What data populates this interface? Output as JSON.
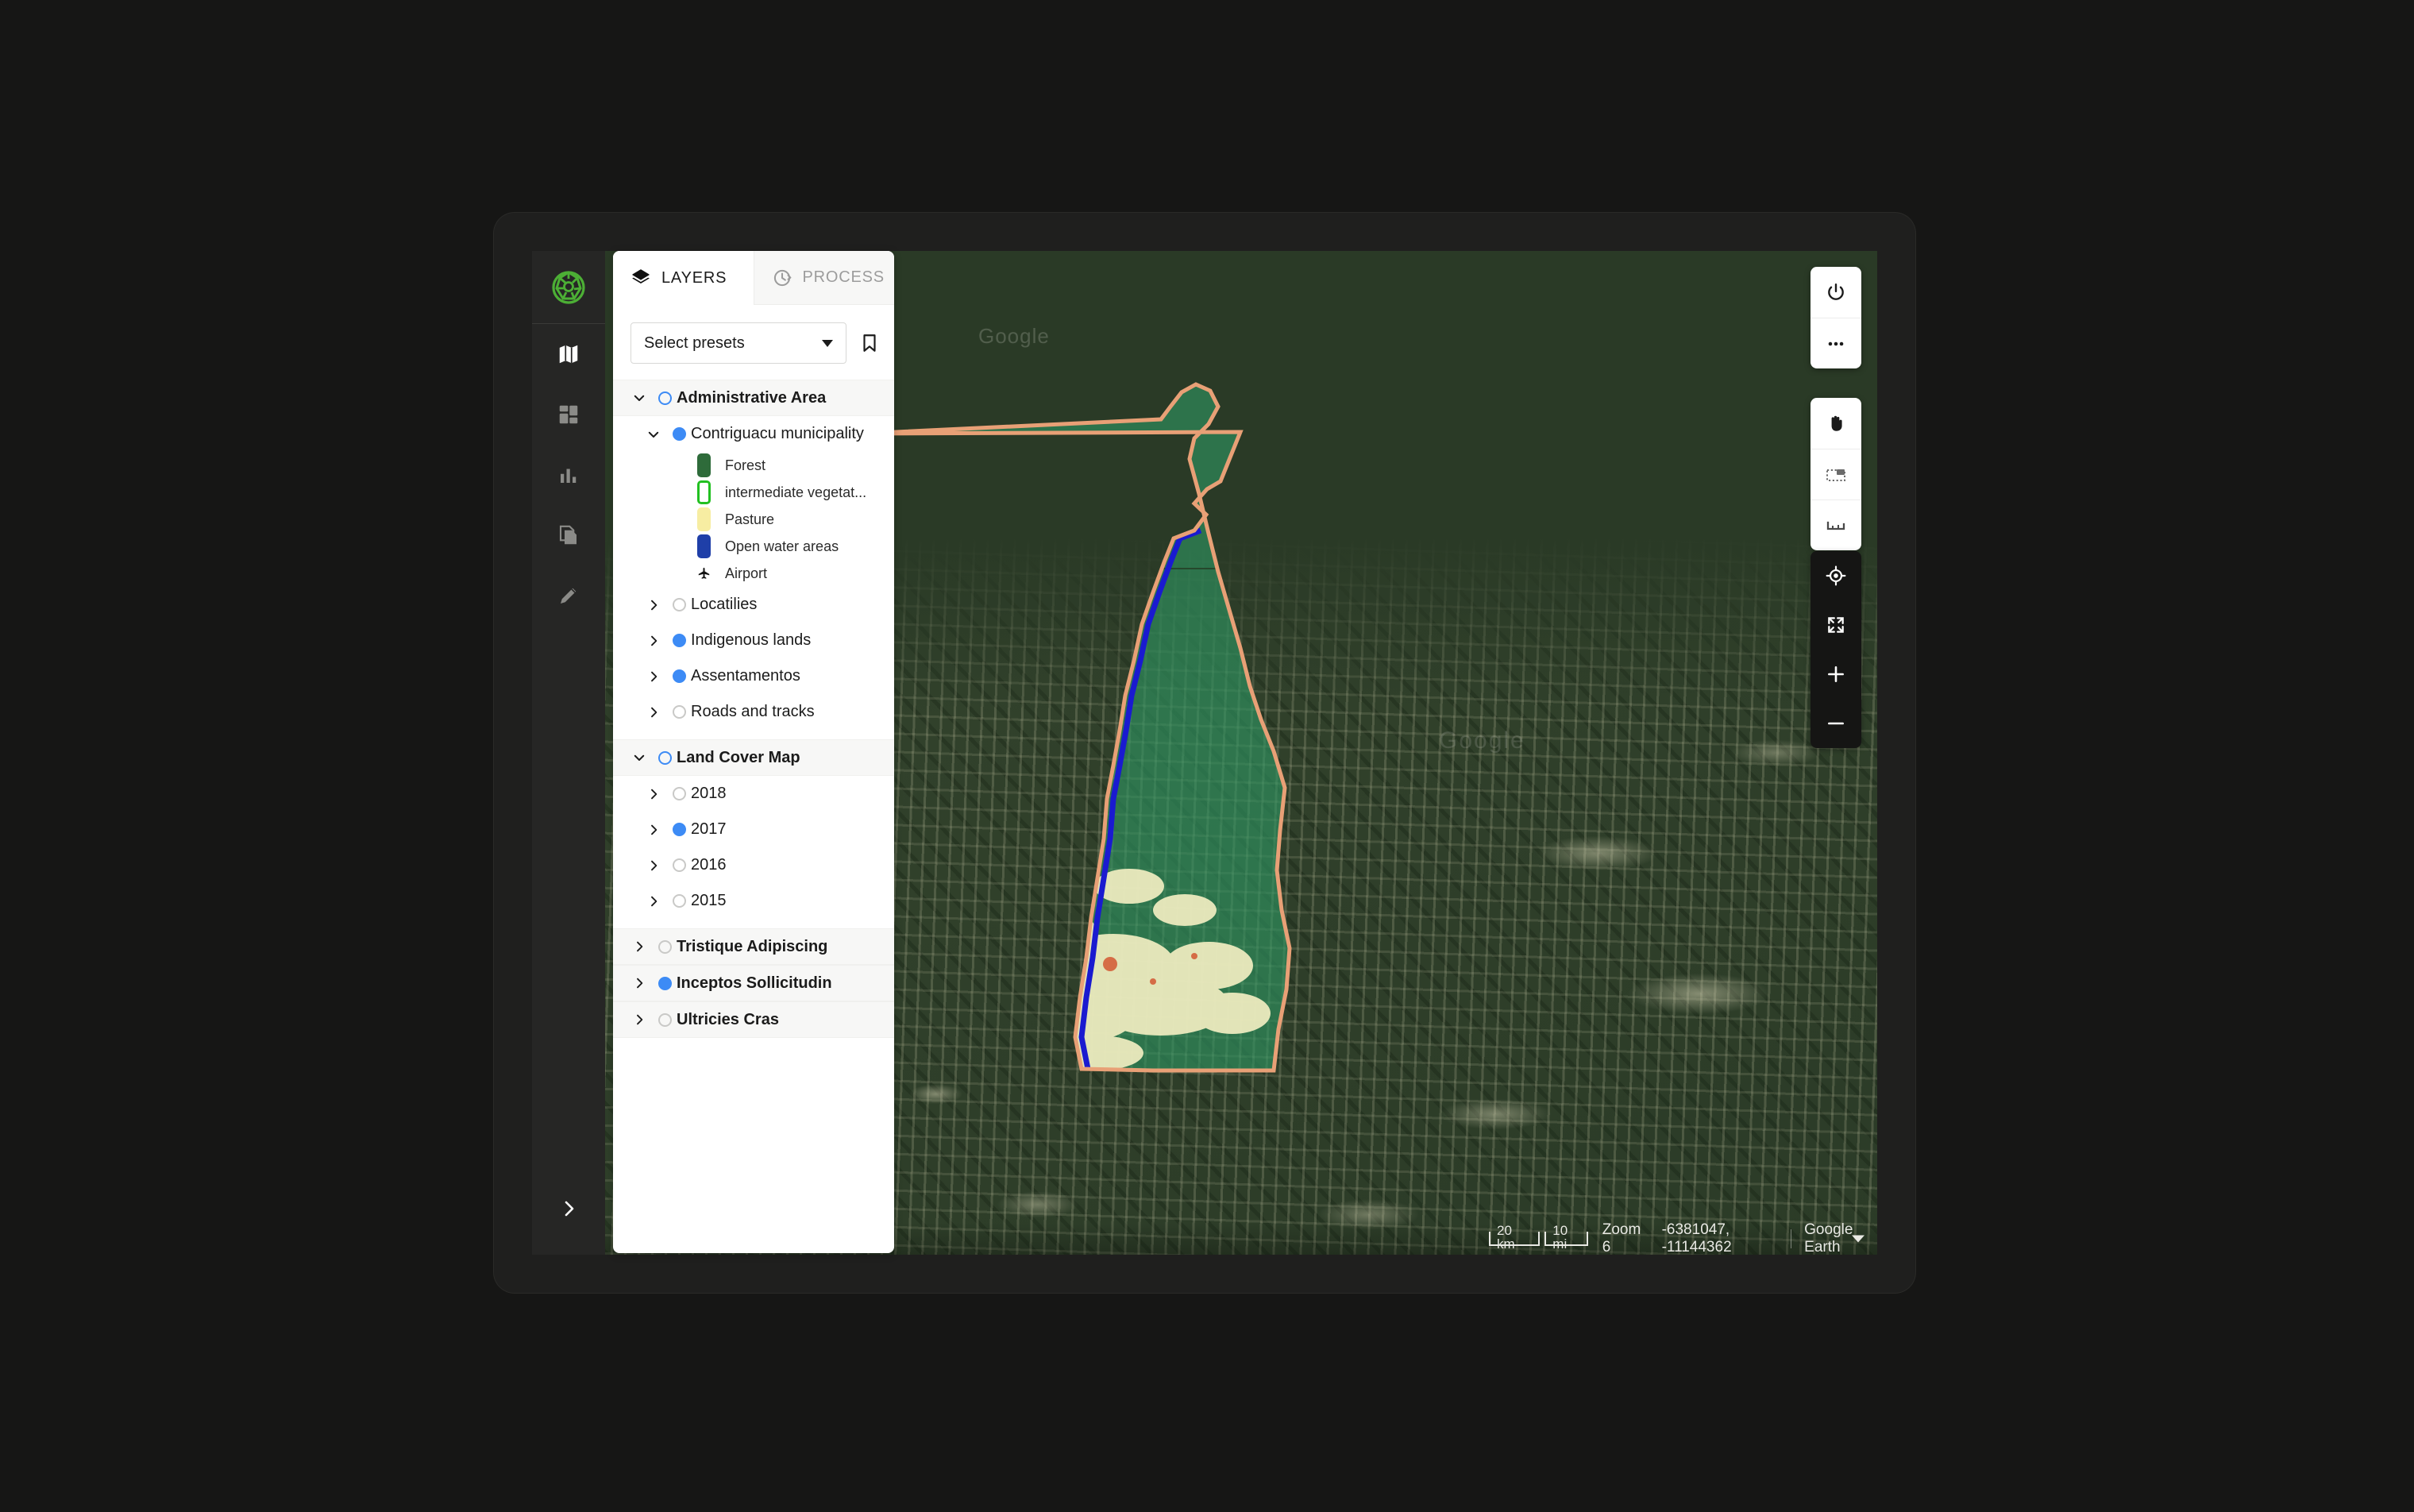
{
  "rail": {
    "logo_icon": "globe-logo-icon",
    "logo_color": "#4caf35",
    "items": [
      {
        "icon": "map-icon",
        "name": "rail-item-map",
        "active": true
      },
      {
        "icon": "dashboard-icon",
        "name": "rail-item-dashboard",
        "active": false
      },
      {
        "icon": "bar-chart-icon",
        "name": "rail-item-analytics",
        "active": false
      },
      {
        "icon": "documents-icon",
        "name": "rail-item-documents",
        "active": false
      },
      {
        "icon": "pencil-icon",
        "name": "rail-item-edit",
        "active": false
      }
    ],
    "expand_icon": "chevron-right-icon"
  },
  "panel": {
    "tabs": [
      {
        "label": "LAYERS",
        "icon": "layers-icon",
        "active": true
      },
      {
        "label": "PROCESS",
        "icon": "history-icon",
        "active": false
      }
    ],
    "presets": {
      "value": "Select presets",
      "placeholder": "Select presets",
      "caret_icon": "chevron-down-icon",
      "bookmark_icon": "bookmark-icon"
    },
    "tree": [
      {
        "label": "Administrative Area",
        "type": "group",
        "expanded": true,
        "toggle": "ring",
        "children": [
          {
            "label": "Contriguacu municipality",
            "type": "node",
            "expanded": true,
            "toggle": "on",
            "legend": [
              {
                "label": "Forest",
                "swatch": "#2e6b3a",
                "style": "fill"
              },
              {
                "label": "intermediate vegetat...",
                "swatch": "#22c021",
                "style": "outline"
              },
              {
                "label": "Pasture",
                "swatch": "#f7eda2",
                "style": "fill"
              },
              {
                "label": "Open water areas",
                "swatch": "#1f3fa8",
                "style": "fill"
              },
              {
                "label": "Airport",
                "swatch": "#111111",
                "style": "icon"
              }
            ]
          },
          {
            "label": "Locatilies",
            "type": "node",
            "expanded": false,
            "toggle": "off"
          },
          {
            "label": "Indigenous lands",
            "type": "node",
            "expanded": false,
            "toggle": "on"
          },
          {
            "label": "Assentamentos",
            "type": "node",
            "expanded": false,
            "toggle": "on"
          },
          {
            "label": "Roads and tracks",
            "type": "node",
            "expanded": false,
            "toggle": "off"
          }
        ]
      },
      {
        "label": "Land Cover Map",
        "type": "group",
        "expanded": true,
        "toggle": "ring",
        "children": [
          {
            "label": "2018",
            "type": "node",
            "expanded": false,
            "toggle": "off"
          },
          {
            "label": "2017",
            "type": "node",
            "expanded": false,
            "toggle": "on"
          },
          {
            "label": "2016",
            "type": "node",
            "expanded": false,
            "toggle": "off"
          },
          {
            "label": "2015",
            "type": "node",
            "expanded": false,
            "toggle": "off"
          }
        ]
      },
      {
        "label": "Tristique Adipiscing",
        "type": "group",
        "expanded": false,
        "toggle": "off",
        "children": []
      },
      {
        "label": "Inceptos Sollicitudin",
        "type": "group",
        "expanded": false,
        "toggle": "on",
        "children": []
      },
      {
        "label": "Ultricies Cras",
        "type": "group",
        "expanded": false,
        "toggle": "off",
        "children": []
      }
    ]
  },
  "map": {
    "watermark": "Google",
    "watermark_secondary": "Google",
    "statusbar": {
      "scale_km": "20 km",
      "scale_mi": "10 mi",
      "zoom": "Zoom 6",
      "coordinates": "-6381047, -11144362",
      "provider": "Google Earth",
      "provider_caret_icon": "caret-down-icon"
    },
    "tools": {
      "power_icon": "power-icon",
      "more_icon": "more-horizontal-icon",
      "pan_icon": "hand-pan-icon",
      "select_icon": "select-box-icon",
      "measure_icon": "measure-icon",
      "locate_icon": "locate-target-icon",
      "fullscreen_icon": "fullscreen-icon",
      "zoom_in_icon": "plus-icon",
      "zoom_out_icon": "minus-icon"
    },
    "colors": {
      "boundary": "#e8a076",
      "river": "#1a1ad0",
      "highlight_fill": "rgba(46,150,98,0.62)",
      "pasture": "#f2eec2"
    }
  }
}
